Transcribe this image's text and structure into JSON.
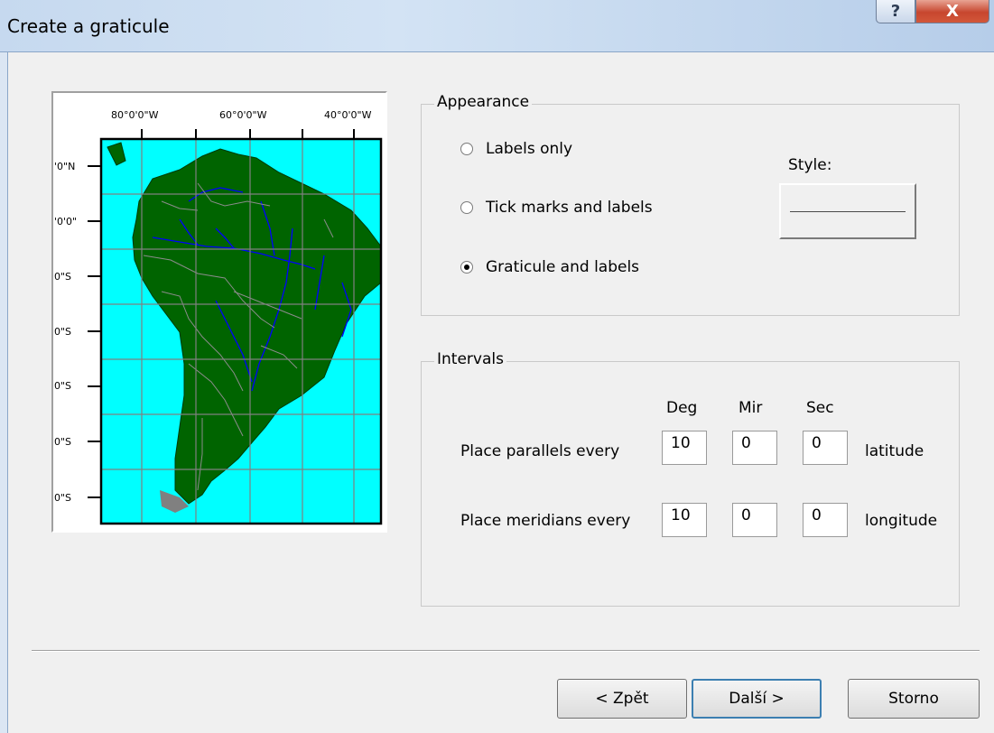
{
  "window": {
    "title": "Create a graticule",
    "help_glyph": "?",
    "close_glyph": "X"
  },
  "preview": {
    "top_labels": [
      "80°0'0\"W",
      "60°0'0\"W",
      "40°0'0\"W"
    ],
    "left_labels": [
      "'0\"N",
      "'0'0\"",
      "0\"S",
      "0\"S",
      "0\"S",
      "0\"S",
      "0\"S"
    ],
    "colors": {
      "ocean": "#00ffff",
      "land": "#006400",
      "rivers": "#0000ff",
      "borders": "#8c8c8c",
      "grid": "#808080"
    }
  },
  "appearance": {
    "title": "Appearance",
    "options": [
      {
        "label": "Labels only",
        "selected": false
      },
      {
        "label": "Tick marks and labels",
        "selected": false
      },
      {
        "label": "Graticule and labels",
        "selected": true
      }
    ],
    "style_label": "Style:"
  },
  "intervals": {
    "title": "Intervals",
    "headers": [
      "Deg",
      "Mir",
      "Sec"
    ],
    "rows": [
      {
        "label": "Place parallels every",
        "deg": "10",
        "min": "0",
        "sec": "0",
        "unit": "latitude"
      },
      {
        "label": "Place meridians every",
        "deg": "10",
        "min": "0",
        "sec": "0",
        "unit": "longitude"
      }
    ]
  },
  "buttons": {
    "back": "< Zpět",
    "next": "Další >",
    "cancel": "Storno"
  }
}
